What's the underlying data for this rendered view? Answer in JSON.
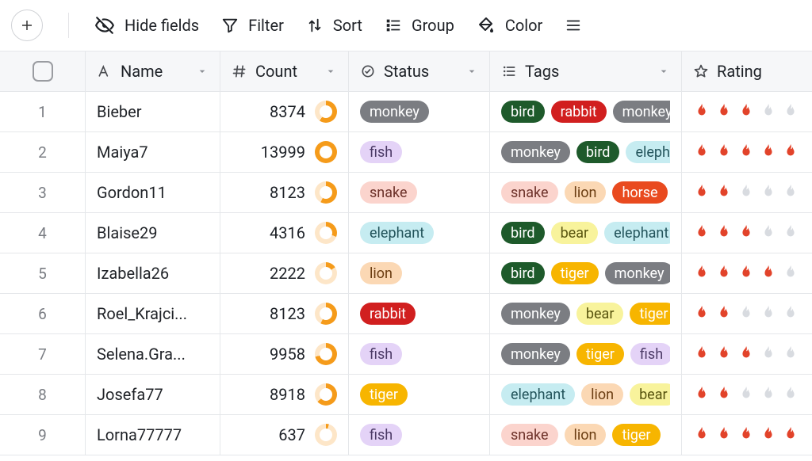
{
  "toolbar": {
    "hide_fields": "Hide fields",
    "filter": "Filter",
    "sort": "Sort",
    "group": "Group",
    "color": "Color"
  },
  "columns": {
    "name": "Name",
    "count": "Count",
    "status": "Status",
    "tags": "Tags",
    "rating": "Rating"
  },
  "max_count": 14000,
  "rows": [
    {
      "idx": 1,
      "name": "Bieber",
      "count": 8374,
      "status": "monkey",
      "tags": [
        "bird",
        "rabbit",
        "monkey"
      ],
      "rating": 3
    },
    {
      "idx": 2,
      "name": "Maiya7",
      "count": 13999,
      "status": "fish",
      "tags": [
        "monkey",
        "bird",
        "elephant"
      ],
      "rating": 5
    },
    {
      "idx": 3,
      "name": "Gordon11",
      "count": 8123,
      "status": "snake",
      "tags": [
        "snake",
        "lion",
        "horse"
      ],
      "rating": 2
    },
    {
      "idx": 4,
      "name": "Blaise29",
      "count": 4316,
      "status": "elephant",
      "tags": [
        "bird",
        "bear",
        "elephant"
      ],
      "rating": 3
    },
    {
      "idx": 5,
      "name": "Izabella26",
      "count": 2222,
      "status": "lion",
      "tags": [
        "bird",
        "tiger",
        "monkey"
      ],
      "rating": 4
    },
    {
      "idx": 6,
      "name": "Roel_Krajci...",
      "count": 8123,
      "status": "rabbit",
      "tags": [
        "monkey",
        "bear",
        "tiger"
      ],
      "rating": 2
    },
    {
      "idx": 7,
      "name": "Selena.Gra...",
      "count": 9958,
      "status": "fish",
      "tags": [
        "monkey",
        "tiger",
        "fish"
      ],
      "rating": 3
    },
    {
      "idx": 8,
      "name": "Josefa77",
      "count": 8918,
      "status": "tiger",
      "tags": [
        "elephant",
        "lion",
        "bear"
      ],
      "rating": 2
    },
    {
      "idx": 9,
      "name": "Lorna77777",
      "count": 637,
      "status": "fish",
      "tags": [
        "snake",
        "lion",
        "tiger"
      ],
      "rating": 5
    }
  ]
}
